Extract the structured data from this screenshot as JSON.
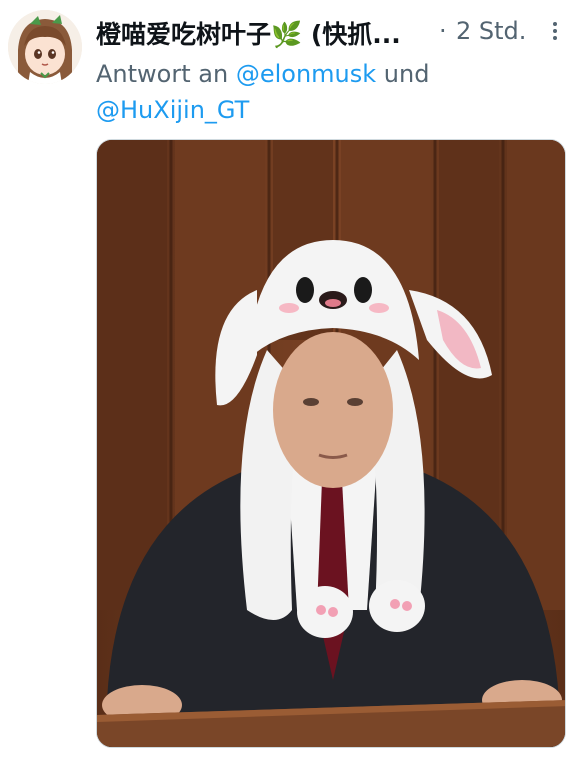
{
  "tweet": {
    "display_name": "橙喵爱吃树叶子🌿 (快抓...",
    "separator": "·",
    "timestamp": "2 Std.",
    "reply_prefix": "Antwort an",
    "mention_1": "@elonmusk",
    "reply_and": "und",
    "mention_2": "@HuXijin_GT"
  },
  "colors": {
    "secondary_text": "#536471",
    "link": "#1d9bf0",
    "background": "#ffffff"
  },
  "icons": {
    "more": "more-vertical-dots-icon",
    "emoji": "herb-emoji"
  }
}
